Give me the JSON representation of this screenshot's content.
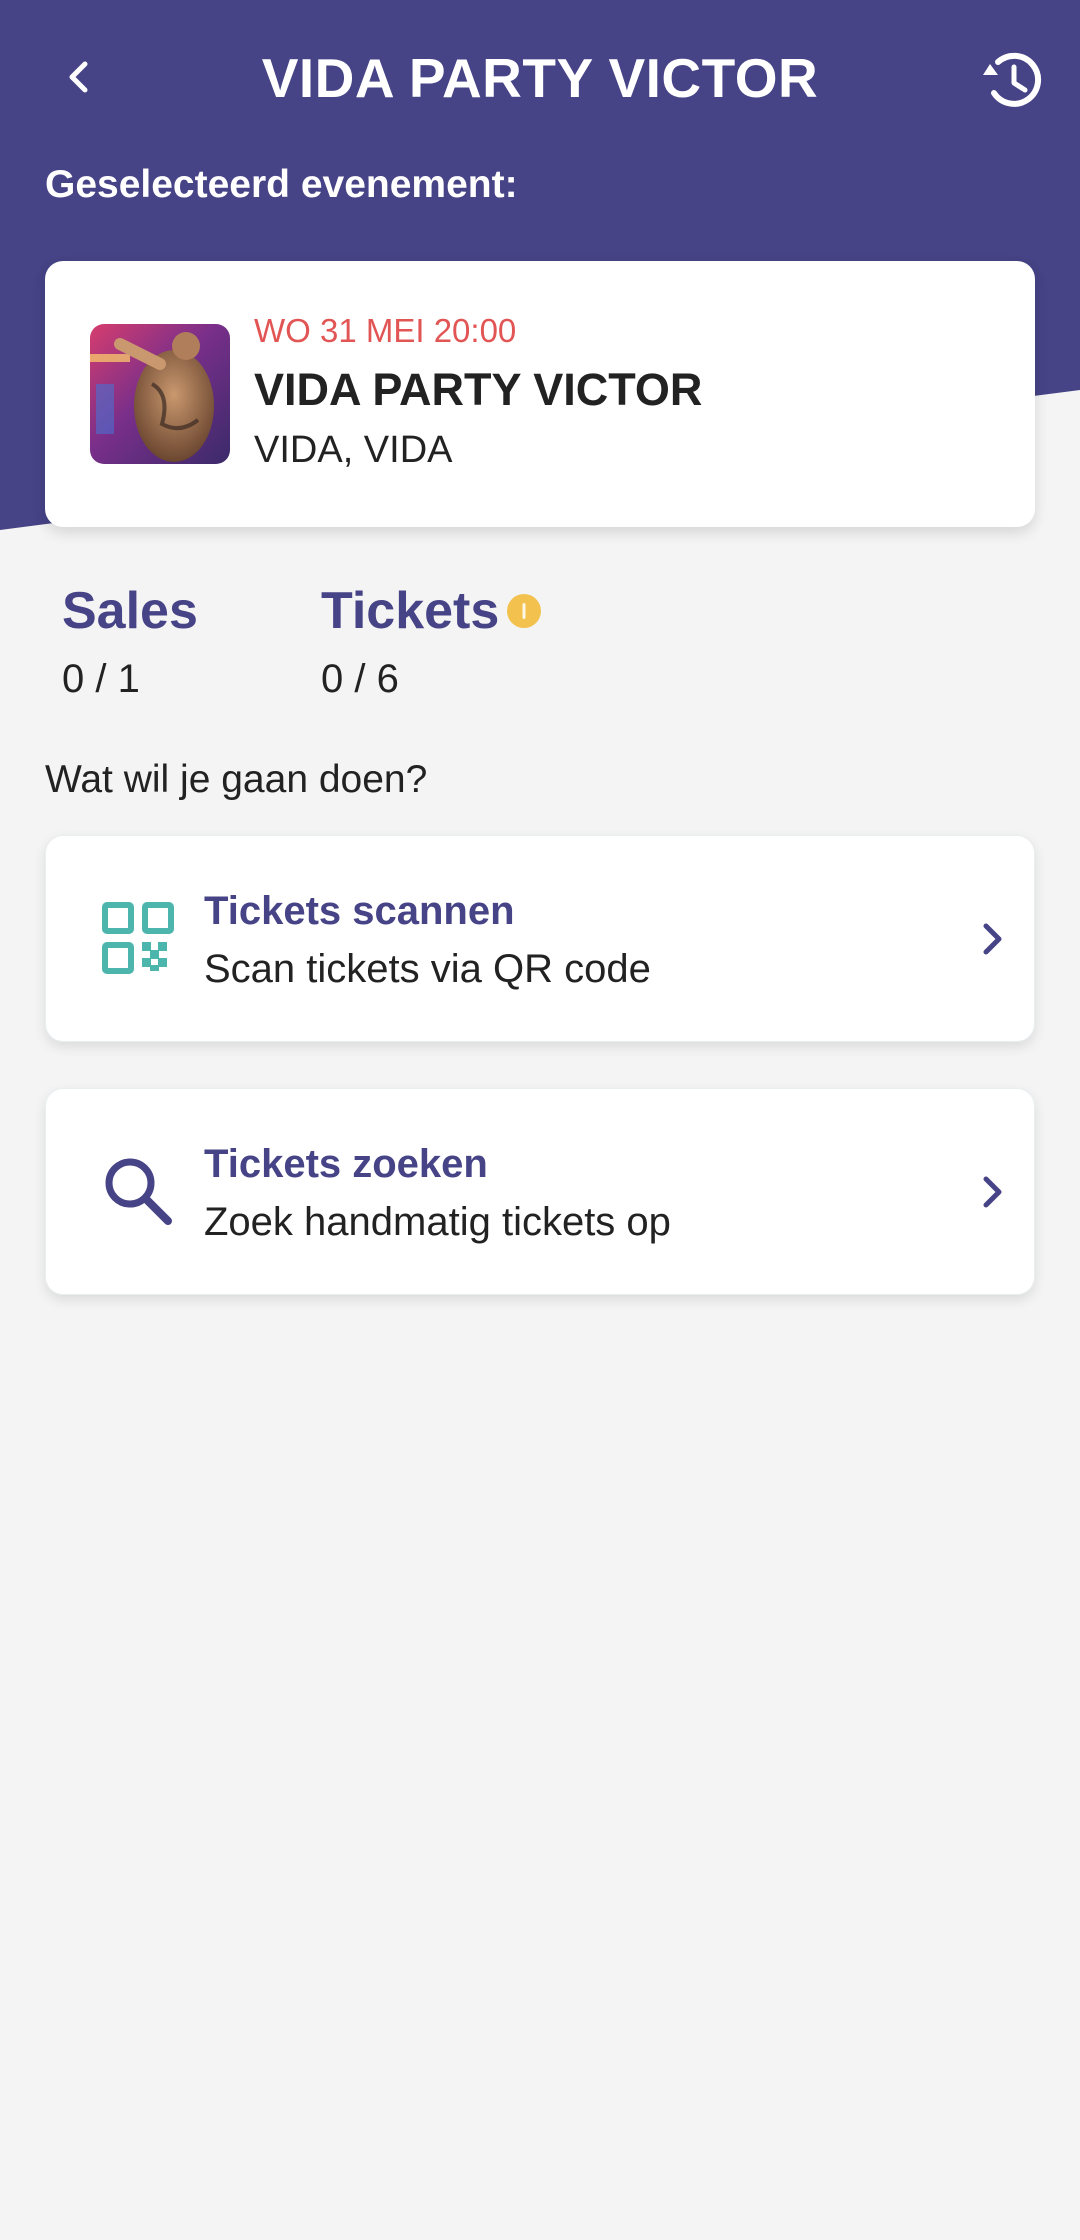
{
  "header": {
    "title": "VIDA PARTY VICTOR",
    "selected_label": "Geselecteerd evenement:"
  },
  "event": {
    "date": "WO 31 MEI 20:00",
    "name": "VIDA PARTY VICTOR",
    "venue": "VIDA, VIDA"
  },
  "stats": {
    "sales_label": "Sales",
    "sales_value": "0 / 1",
    "tickets_label": "Tickets",
    "tickets_value": "0 / 6",
    "tickets_info_icon": "info-icon"
  },
  "question": "Wat wil je gaan doen?",
  "actions": [
    {
      "title": "Tickets scannen",
      "subtitle": "Scan tickets via QR code",
      "icon": "qr-code-icon"
    },
    {
      "title": "Tickets zoeken",
      "subtitle": "Zoek handmatig tickets op",
      "icon": "search-icon"
    }
  ],
  "colors": {
    "primary": "#464386",
    "date_accent": "#e25555",
    "qr_icon": "#4db6ac",
    "info_dot": "#f2c14e",
    "background": "#f4f4f4"
  }
}
